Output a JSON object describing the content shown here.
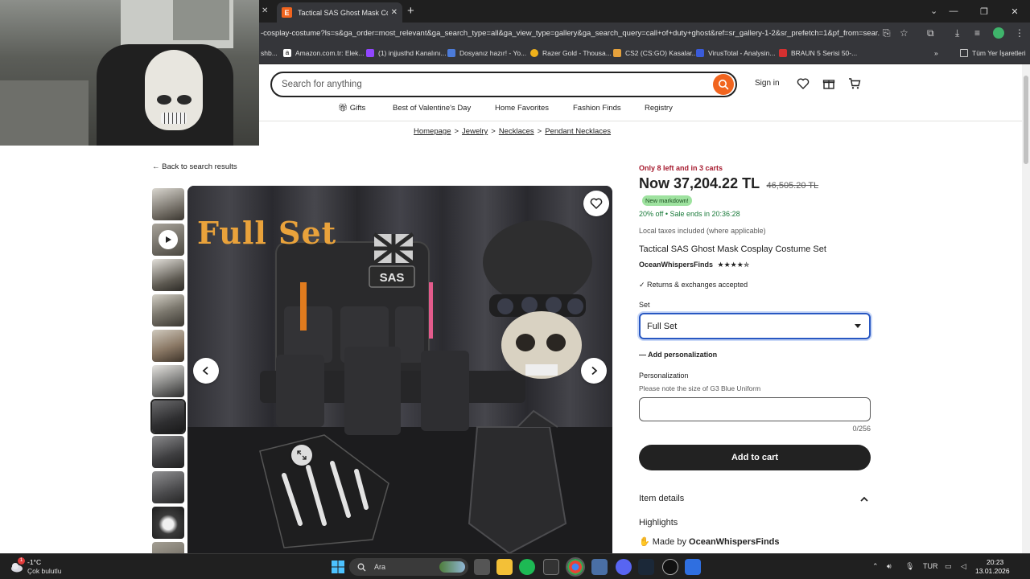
{
  "browser": {
    "tab_title": "Tactical SAS Ghost Mask Cosplay",
    "tab_favicon_letter": "E",
    "url": "-cosplay-costume?ls=s&ga_order=most_relevant&ga_search_type=all&ga_view_type=gallery&ga_search_query=call+of+duty+ghost&ref=sr_gallery-1-2&sr_prefetch=1&pf_from=sear...",
    "bookmarks": [
      {
        "label": "shb...",
        "color": "#555555"
      },
      {
        "label": "Amazon.com.tr: Elek...",
        "color": "#ffffff"
      },
      {
        "label": "(1) injjusthd Kanalını...",
        "color": "#9146ff"
      },
      {
        "label": "Dosyanız hazır! - Yo...",
        "color": "#4c7bd9"
      },
      {
        "label": "Razer Gold - Thousa...",
        "color": "#f0b21b"
      },
      {
        "label": "CS2 (CS:GO) Kasalar...",
        "color": "#e6a23c"
      },
      {
        "label": "VirusTotal - Analysin...",
        "color": "#3a5bd9"
      },
      {
        "label": "BRAUN 5 Serisi 50-...",
        "color": "#d43030"
      }
    ],
    "all_bookmarks": "Tüm Yer İşaretleri"
  },
  "header": {
    "search_placeholder": "Search for anything",
    "signin": "Sign in"
  },
  "categories": [
    "Gifts",
    "Best of Valentine's Day",
    "Home Favorites",
    "Fashion Finds",
    "Registry"
  ],
  "breadcrumbs": [
    "Homepage",
    "Jewelry",
    "Necklaces",
    "Pendant Necklaces"
  ],
  "back_link": "Back to search results",
  "image": {
    "overlay_text": "Full Set",
    "patch_text": "SAS"
  },
  "product": {
    "stock_notice": "Only 8 left and in 3 carts",
    "price_now": "Now 37,204.22 TL",
    "price_old": "46,505.20 TL",
    "markdown_badge": "New markdown!",
    "sale_text": "20% off  •  Sale ends in 20:36:28",
    "tax_note": "Local taxes included (where applicable)",
    "title": "Tactical SAS Ghost Mask Cosplay Costume Set",
    "shop_name": "OceanWhispersFinds",
    "rating_stars": "★★★★✯",
    "returns": "Returns & exchanges accepted",
    "set_label": "Set",
    "set_selected": "Full Set",
    "add_personalization": "Add personalization",
    "personalization_label": "Personalization",
    "personalization_note": "Please note the size of G3 Blue Uniform",
    "personalization_value": "",
    "char_count": "0/256",
    "add_to_cart": "Add to cart",
    "item_details": "Item details",
    "highlights": "Highlights",
    "made_by_prefix": "Made by",
    "made_by_shop": "OceanWhispersFinds"
  },
  "taskbar": {
    "temperature": "-1°C",
    "weather": "Çok bulutlu",
    "weather_badge": "1",
    "search_label": "Ara",
    "language": "TUR",
    "time": "20:23",
    "date": "13.01.2026"
  },
  "colors": {
    "etsy_orange": "#f1641e",
    "stock_red": "#a61a2e",
    "sale_green": "#1a7a3a",
    "select_focus": "#2857c2"
  }
}
